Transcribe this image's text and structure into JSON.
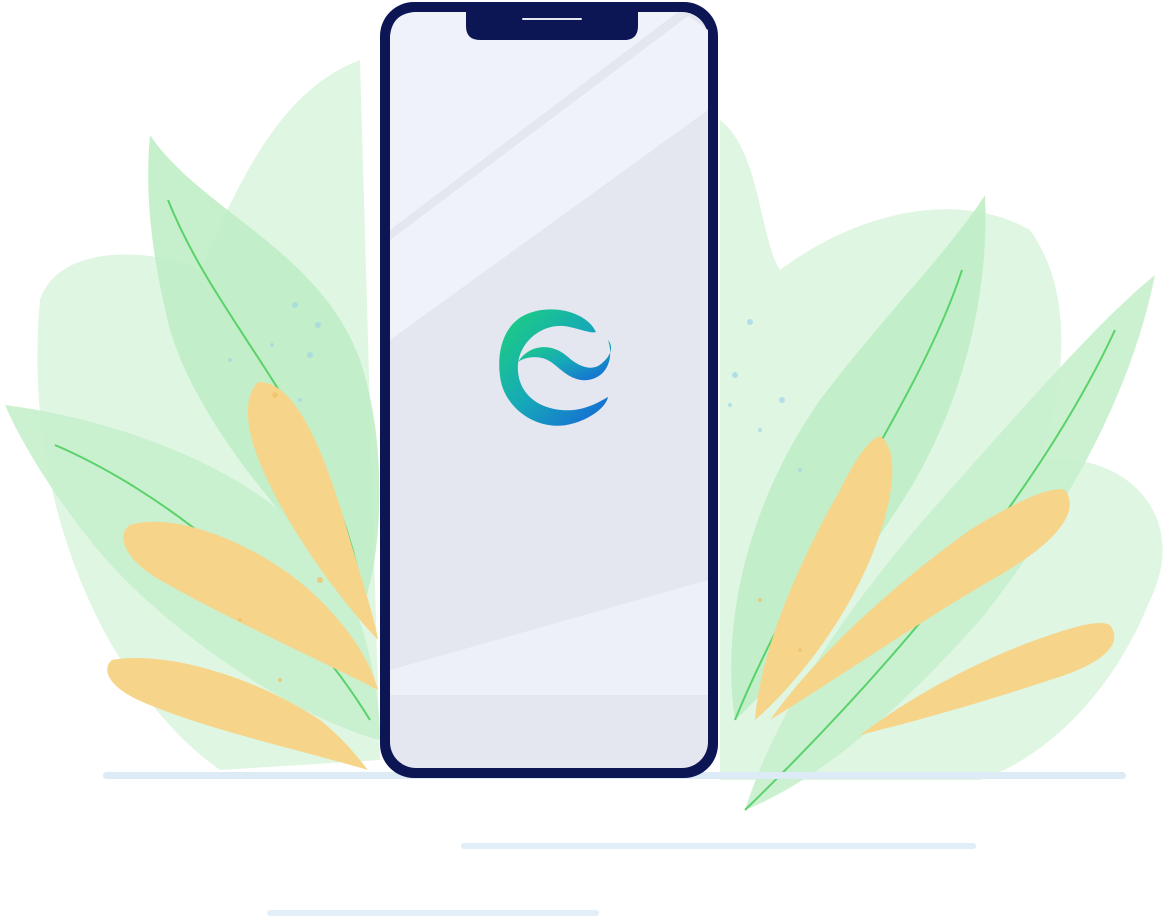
{
  "illustration": {
    "subject": "smartphone-with-app-logo",
    "logo_icon": "app-e-wave-logo-icon",
    "colors": {
      "background": "#ffffff",
      "leaf_light_green": "#d8f3dc",
      "leaf_mid_green": "#b4ebbd",
      "leaf_vein_green": "#5ad26a",
      "leaf_yellow": "#f6d58a",
      "leaf_yellow_vein": "#e8b465",
      "phone_frame": "#0d1654",
      "phone_screen": "#e4e6f0",
      "phone_screen_light": "#eff2f9",
      "ground_line": "#dcebf5",
      "logo_green": "#1ed27a",
      "logo_blue": "#1565d8"
    }
  }
}
